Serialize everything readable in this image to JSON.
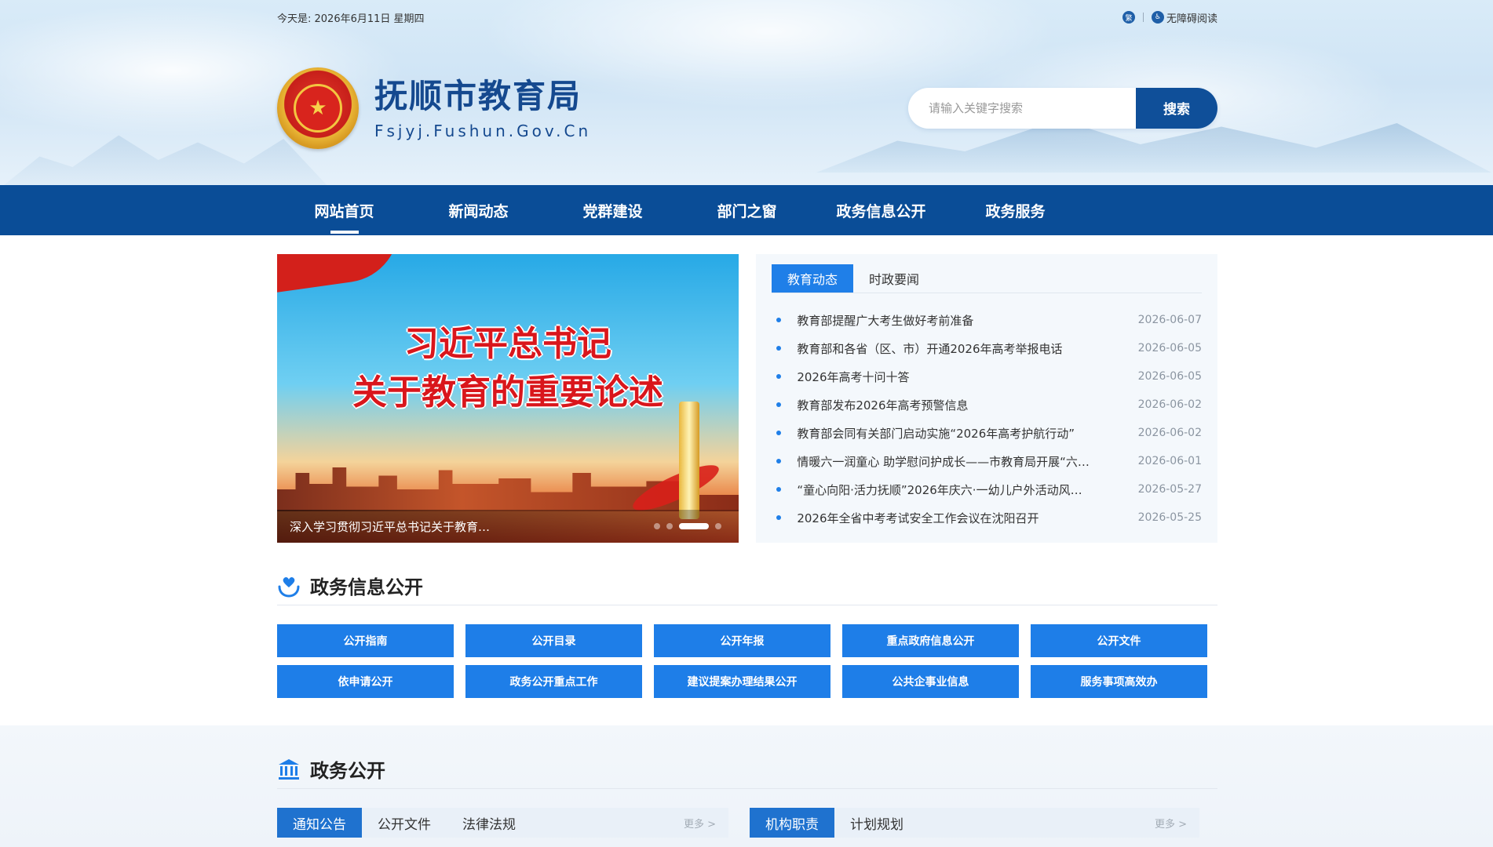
{
  "topbar": {
    "date_text": "今天是: 2026年6月11日 星期四",
    "lang_icon_char": "繁",
    "accessibility_label": "无障碍阅读"
  },
  "header": {
    "site_name": "抚顺市教育局",
    "site_domain": "Fsjyj.Fushun.Gov.Cn",
    "search_placeholder": "请输入关键字搜索",
    "search_button": "搜索"
  },
  "nav": {
    "items": [
      "网站首页",
      "新闻动态",
      "党群建设",
      "部门之窗",
      "政务信息公开",
      "政务服务"
    ],
    "active_index": 0
  },
  "banner": {
    "title_line1": "习近平总书记",
    "title_line2": "关于教育的重要论述",
    "caption": "深入学习贯彻习近平总书记关于教育…",
    "dots_total": 5,
    "active_dot": 3
  },
  "news": {
    "tabs": [
      "教育动态",
      "时政要闻"
    ],
    "active_tab": 0,
    "items": [
      {
        "title": "教育部提醒广大考生做好考前准备",
        "date": "2026-06-07"
      },
      {
        "title": "教育部和各省（区、市）开通2026年高考举报电话",
        "date": "2026-06-05"
      },
      {
        "title": "2026年高考十问十答",
        "date": "2026-06-05"
      },
      {
        "title": "教育部发布2026年高考预警信息",
        "date": "2026-06-02"
      },
      {
        "title": "教育部会同有关部门启动实施“2026年高考护航行动”",
        "date": "2026-06-02"
      },
      {
        "title": "情暖六一润童心 助学慰问护成长——市教育局开展“六…",
        "date": "2026-06-01"
      },
      {
        "title": "“童心向阳·活力抚顺”2026年庆六·一幼儿户外活动风…",
        "date": "2026-05-27"
      },
      {
        "title": "2026年全省中考考试安全工作会议在沈阳召开",
        "date": "2026-05-25"
      }
    ]
  },
  "gov_info": {
    "title": "政务信息公开",
    "buttons": [
      "公开指南",
      "公开目录",
      "公开年报",
      "重点政府信息公开",
      "公开文件",
      "依申请公开",
      "政务公开重点工作",
      "建议提案办理结果公开",
      "公共企事业信息",
      "服务事项高效办"
    ]
  },
  "gov_public": {
    "title": "政务公开",
    "left_tabs": [
      "通知公告",
      "公开文件",
      "法律法规"
    ],
    "left_more": "更多 >",
    "right_tabs": [
      "机构职责",
      "计划规划"
    ],
    "right_more": "更多 >"
  },
  "colors": {
    "nav_bg": "#0a4d97",
    "accent_blue": "#1e7ee8",
    "title_blue": "#15498f"
  }
}
